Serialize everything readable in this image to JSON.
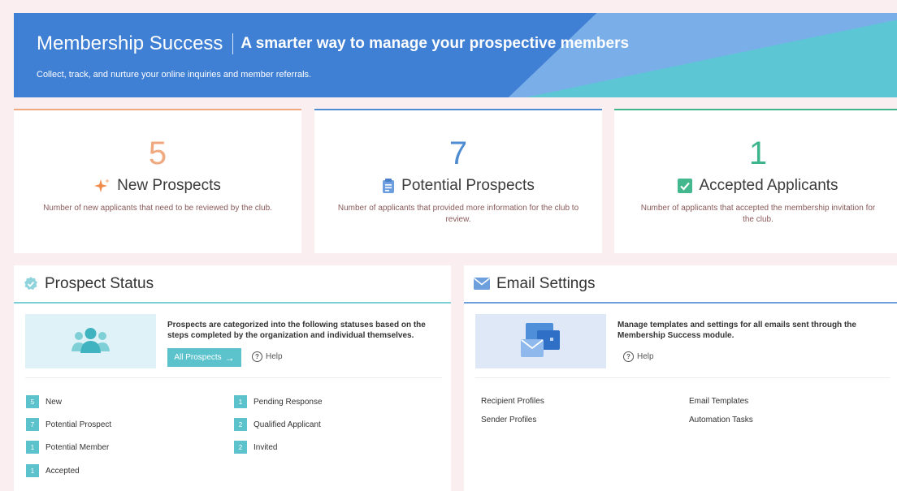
{
  "banner": {
    "title": "Membership Success",
    "tagline": "A smarter way to manage your prospective members",
    "subtitle": "Collect, track, and nurture your online inquiries and member referrals."
  },
  "cards": [
    {
      "count": "5",
      "label": "New Prospects",
      "desc": "Number of new applicants that need to be reviewed by the club.",
      "color": "#f0a97e",
      "icon": "sparkle-icon"
    },
    {
      "count": "7",
      "label": "Potential Prospects",
      "desc": "Number of applicants that provided more information for the club to review.",
      "color": "#4f8bd0",
      "icon": "clipboard-icon"
    },
    {
      "count": "1",
      "label": "Accepted Applicants",
      "desc": "Number of applicants that accepted the membership invitation for the club.",
      "color": "#3fb58e",
      "icon": "checkbox-icon"
    }
  ],
  "prospect_status": {
    "title": "Prospect Status",
    "info": "Prospects are categorized into the following statuses based on the steps completed by the organization and individual themselves.",
    "all_button": "All Prospects",
    "help": "Help",
    "statuses": [
      {
        "count": "5",
        "label": "New"
      },
      {
        "count": "7",
        "label": "Potential Prospect"
      },
      {
        "count": "1",
        "label": "Potential Member"
      },
      {
        "count": "1",
        "label": "Accepted"
      },
      {
        "count": "1",
        "label": "Pending Response"
      },
      {
        "count": "2",
        "label": "Qualified Applicant"
      },
      {
        "count": "2",
        "label": "Invited"
      }
    ]
  },
  "email_settings": {
    "title": "Email Settings",
    "info": "Manage templates and settings for all emails sent through the Membership Success module.",
    "help": "Help",
    "links": [
      "Recipient Profiles",
      "Sender Profiles",
      "Email Templates",
      "Automation Tasks"
    ]
  }
}
